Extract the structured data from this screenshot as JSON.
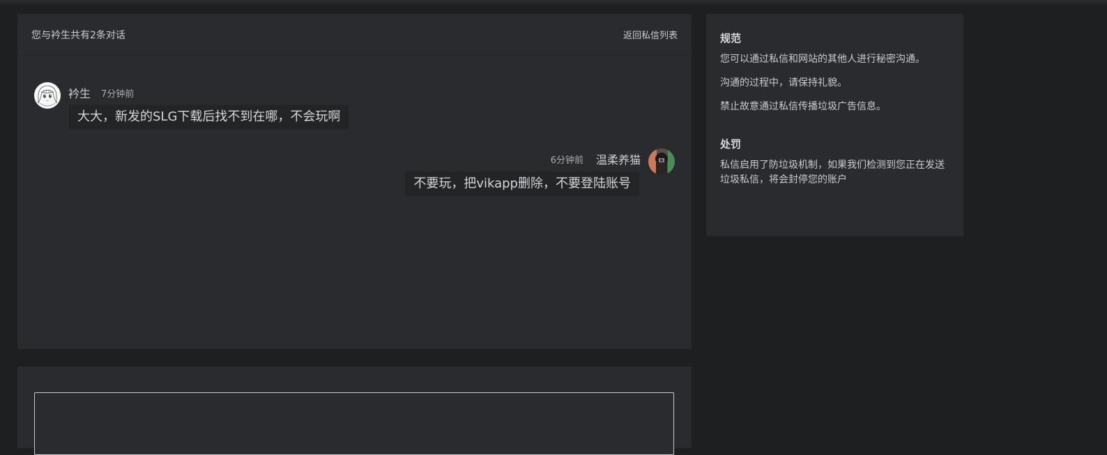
{
  "conversation": {
    "title": "您与衿生共有2条对话",
    "back_label": "返回私信列表"
  },
  "messages": [
    {
      "name": "衿生",
      "time": "7分钟前",
      "text": "大大，新发的SLG下载后找不到在哪，不会玩啊",
      "side": "left"
    },
    {
      "name": "温柔养猫",
      "time": "6分钟前",
      "text": "不要玩，把vikapp删除，不要登陆账号",
      "side": "right"
    }
  ],
  "sidebar": {
    "rules_title": "规范",
    "rules": [
      "您可以通过私信和网站的其他人进行秘密沟通。",
      "沟通的过程中，请保持礼貌。",
      "禁止故意通过私信传播垃圾广告信息。"
    ],
    "penalty_title": "处罚",
    "penalty_text": "私信启用了防垃圾机制，如果我们检测到您正在发送垃圾私信，将会封停您的账户"
  },
  "reply": {
    "value": ""
  },
  "colors": {
    "page_bg": "#1e1f21",
    "panel_bg": "#292b2e",
    "bubble_bg": "#222426"
  },
  "icons": {
    "avatar_left": "anime-girl-avatar",
    "avatar_right": "user-photo-avatar"
  }
}
